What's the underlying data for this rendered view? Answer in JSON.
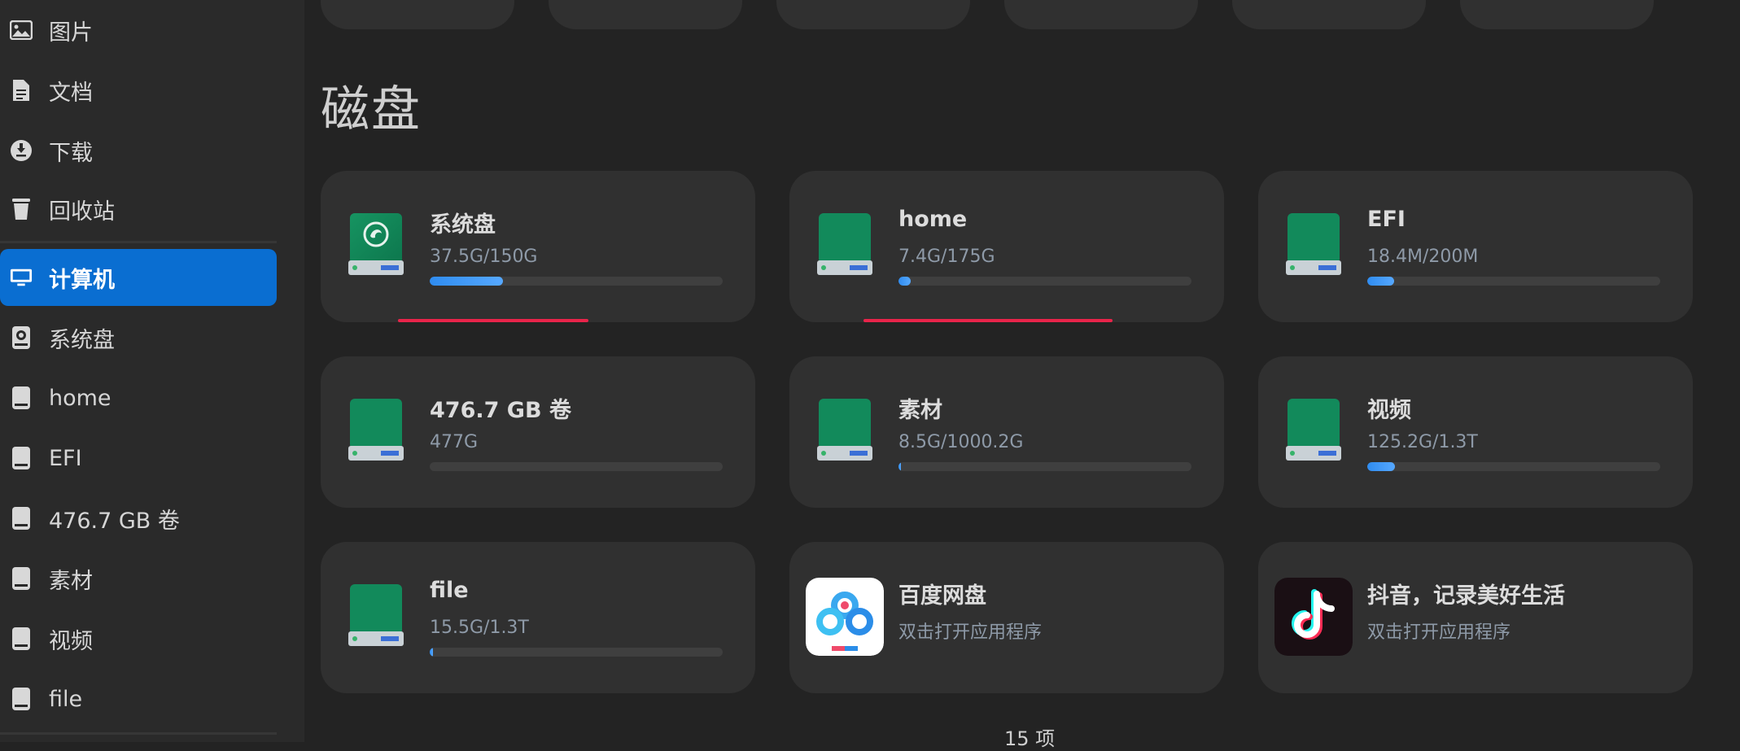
{
  "sidebar": {
    "items": [
      {
        "label": "图片",
        "icon": "image-icon"
      },
      {
        "label": "文档",
        "icon": "document-icon"
      },
      {
        "label": "下载",
        "icon": "download-icon"
      },
      {
        "label": "回收站",
        "icon": "trash-icon"
      },
      {
        "label": "计算机",
        "icon": "computer-icon",
        "active": true
      },
      {
        "label": "系统盘",
        "icon": "system-disk-icon"
      },
      {
        "label": "home",
        "icon": "drive-icon"
      },
      {
        "label": "EFI",
        "icon": "drive-icon"
      },
      {
        "label": "476.7 GB 卷",
        "icon": "drive-icon"
      },
      {
        "label": "素材",
        "icon": "drive-icon"
      },
      {
        "label": "视频",
        "icon": "drive-icon"
      },
      {
        "label": "file",
        "icon": "drive-icon"
      }
    ]
  },
  "main": {
    "section_title": "磁盘",
    "cards": [
      {
        "name": "系统盘",
        "usage": "37.5G/150G",
        "progress": 0.25,
        "icon": "system-disk-icon"
      },
      {
        "name": "home",
        "usage": "7.4G/175G",
        "progress": 0.042,
        "icon": "drive-icon"
      },
      {
        "name": "EFI",
        "usage": "18.4M/200M",
        "progress": 0.092,
        "icon": "drive-icon"
      },
      {
        "name": "476.7 GB 卷",
        "usage": "477G",
        "progress": 0.0,
        "icon": "drive-icon"
      },
      {
        "name": "素材",
        "usage": "8.5G/1000.2G",
        "progress": 0.0085,
        "icon": "drive-icon"
      },
      {
        "name": "视频",
        "usage": "125.2G/1.3T",
        "progress": 0.094,
        "icon": "drive-icon"
      },
      {
        "name": "file",
        "usage": "15.5G/1.3T",
        "progress": 0.012,
        "icon": "drive-icon"
      },
      {
        "name": "百度网盘",
        "usage": "双击打开应用程序",
        "icon": "baidu-netdisk-icon"
      },
      {
        "name": "抖音，记录美好生活",
        "usage": "双击打开应用程序",
        "icon": "douyin-icon"
      }
    ],
    "footer_count": "15 项"
  },
  "colors": {
    "accent": "#0a6ed1",
    "progress": "#2f8cf0",
    "underline": "#e8244a",
    "drive_green": "#118a5a"
  }
}
